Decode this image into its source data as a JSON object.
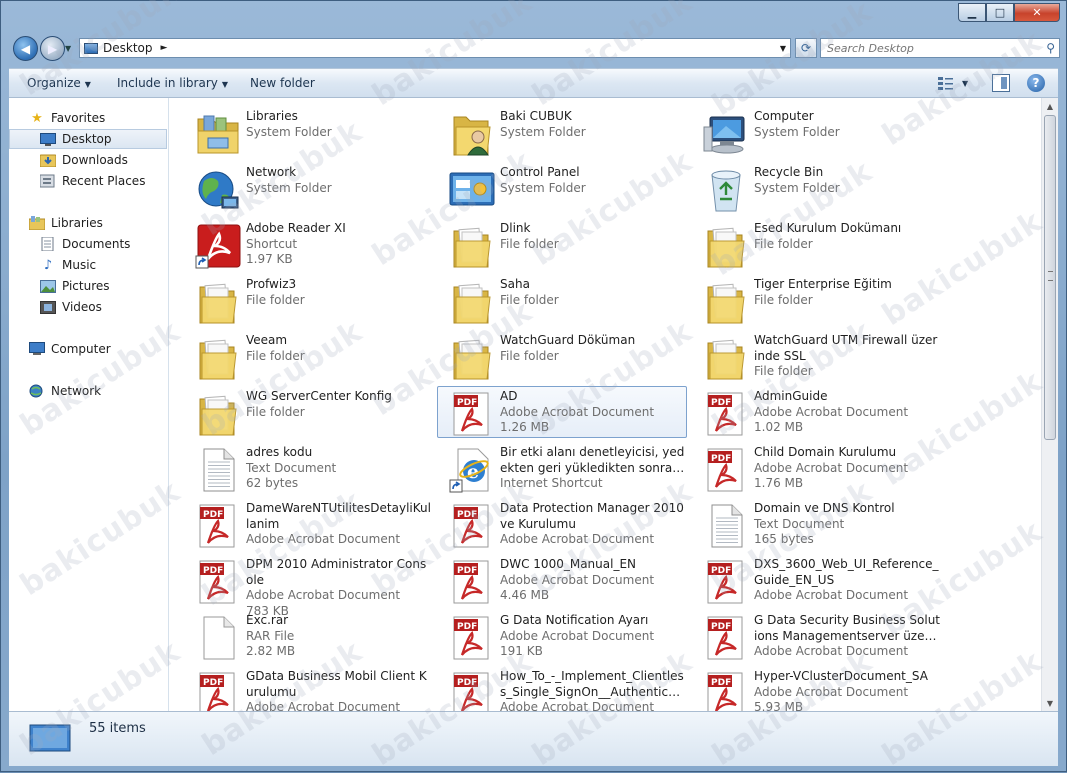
{
  "window": {
    "caption_buttons": {
      "minimize": "▁",
      "maximize": "□",
      "close": "✕"
    }
  },
  "address": {
    "crumb": "Desktop",
    "separator": "►",
    "dropdown": "▼"
  },
  "search": {
    "placeholder": "Search Desktop"
  },
  "toolbar": {
    "organize": "Organize",
    "include_in_library": "Include in library",
    "new_folder": "New folder",
    "caret": "▼"
  },
  "nav": {
    "favorites": "Favorites",
    "desktop": "Desktop",
    "downloads": "Downloads",
    "recent_places": "Recent Places",
    "libraries": "Libraries",
    "documents": "Documents",
    "music": "Music",
    "pictures": "Pictures",
    "videos": "Videos",
    "computer": "Computer",
    "network": "Network"
  },
  "items": [
    {
      "name": "Libraries",
      "line2": "System Folder",
      "line3": "",
      "icon": "libraries-icon"
    },
    {
      "name": "Baki CUBUK",
      "line2": "System Folder",
      "line3": "",
      "icon": "user-folder-icon"
    },
    {
      "name": "Computer",
      "line2": "System Folder",
      "line3": "",
      "icon": "computer-icon"
    },
    {
      "name": "Network",
      "line2": "System Folder",
      "line3": "",
      "icon": "network-globe-icon"
    },
    {
      "name": "Control Panel",
      "line2": "System Folder",
      "line3": "",
      "icon": "control-panel-icon"
    },
    {
      "name": "Recycle Bin",
      "line2": "System Folder",
      "line3": "",
      "icon": "recycle-bin-icon"
    },
    {
      "name": "Adobe Reader XI",
      "line2": "Shortcut",
      "line3": "1.97 KB",
      "icon": "adobe-reader-shortcut-icon"
    },
    {
      "name": "Dlink",
      "line2": "File folder",
      "line3": "",
      "icon": "folder-icon"
    },
    {
      "name": "Esed Kurulum Dokümanı",
      "line2": "File folder",
      "line3": "",
      "icon": "folder-icon"
    },
    {
      "name": "Profwiz3",
      "line2": "File folder",
      "line3": "",
      "icon": "folder-icon"
    },
    {
      "name": "Saha",
      "line2": "File folder",
      "line3": "",
      "icon": "folder-icon"
    },
    {
      "name": "Tiger Enterprise Eğitim",
      "line2": "File folder",
      "line3": "",
      "icon": "folder-icon"
    },
    {
      "name": "Veeam",
      "line2": "File folder",
      "line3": "",
      "icon": "folder-icon"
    },
    {
      "name": "WatchGuard Döküman",
      "line2": "File folder",
      "line3": "",
      "icon": "folder-icon"
    },
    {
      "name": "WatchGuard UTM Firewall üzerinde SSL",
      "line2": "File folder",
      "line3": "",
      "icon": "folder-icon"
    },
    {
      "name": "WG ServerCenter Konfig",
      "line2": "File folder",
      "line3": "",
      "icon": "folder-icon"
    },
    {
      "name": "AD",
      "line2": "Adobe Acrobat Document",
      "line3": "1.26 MB",
      "icon": "pdf-icon"
    },
    {
      "name": "AdminGuide",
      "line2": "Adobe Acrobat Document",
      "line3": "1.02 MB",
      "icon": "pdf-icon"
    },
    {
      "name": "adres kodu",
      "line2": "Text Document",
      "line3": "62 bytes",
      "icon": "text-document-icon"
    },
    {
      "name": "Bir etki alanı denetleyicisi, yedekten geri yükledikten sonra Sysvol ve ...",
      "line2": "Internet Shortcut",
      "line3": "",
      "icon": "internet-shortcut-icon"
    },
    {
      "name": "Child Domain Kurulumu",
      "line2": "Adobe Acrobat Document",
      "line3": "1.76 MB",
      "icon": "pdf-icon"
    },
    {
      "name": "DameWareNTUtilitesDetayliKullanim",
      "line2": "Adobe Acrobat Document",
      "line3": "",
      "icon": "pdf-icon"
    },
    {
      "name": "Data Protection Manager 2010 ve Kurulumu",
      "line2": "Adobe Acrobat Document",
      "line3": "",
      "icon": "pdf-icon"
    },
    {
      "name": "Domain ve DNS Kontrol",
      "line2": "Text Document",
      "line3": "165 bytes",
      "icon": "text-document-icon"
    },
    {
      "name": "DPM 2010 Administrator Console",
      "line2": "Adobe Acrobat Document",
      "line3": "783 KB",
      "icon": "pdf-icon"
    },
    {
      "name": "DWC 1000_Manual_EN",
      "line2": "Adobe Acrobat Document",
      "line3": "4.46 MB",
      "icon": "pdf-icon"
    },
    {
      "name": "DXS_3600_Web_UI_Reference_Guide_EN_US",
      "line2": "Adobe Acrobat Document",
      "line3": "",
      "icon": "pdf-icon"
    },
    {
      "name": "Exc.rar",
      "line2": "RAR File",
      "line3": "2.82 MB",
      "icon": "blank-file-icon"
    },
    {
      "name": "G Data Notification Ayarı",
      "line2": "Adobe Acrobat Document",
      "line3": "191 KB",
      "icon": "pdf-icon"
    },
    {
      "name": "G Data Security Business Solutions Managementserver üzerinden Cli...",
      "line2": "Adobe Acrobat Document",
      "line3": "",
      "icon": "pdf-icon"
    },
    {
      "name": "GData Business Mobil Client Kurulumu",
      "line2": "Adobe Acrobat Document",
      "line3": "",
      "icon": "pdf-icon"
    },
    {
      "name": "How_To_-_Implement_Clientless_Single_SignOn__Authentication_in_...",
      "line2": "Adobe Acrobat Document",
      "line3": "",
      "icon": "pdf-icon"
    },
    {
      "name": "Hyper-VClusterDocument_SA",
      "line2": "Adobe Acrobat Document",
      "line3": "5.93 MB",
      "icon": "pdf-icon"
    }
  ],
  "status": {
    "count": "55 items"
  },
  "watermark": "bakicubuk"
}
